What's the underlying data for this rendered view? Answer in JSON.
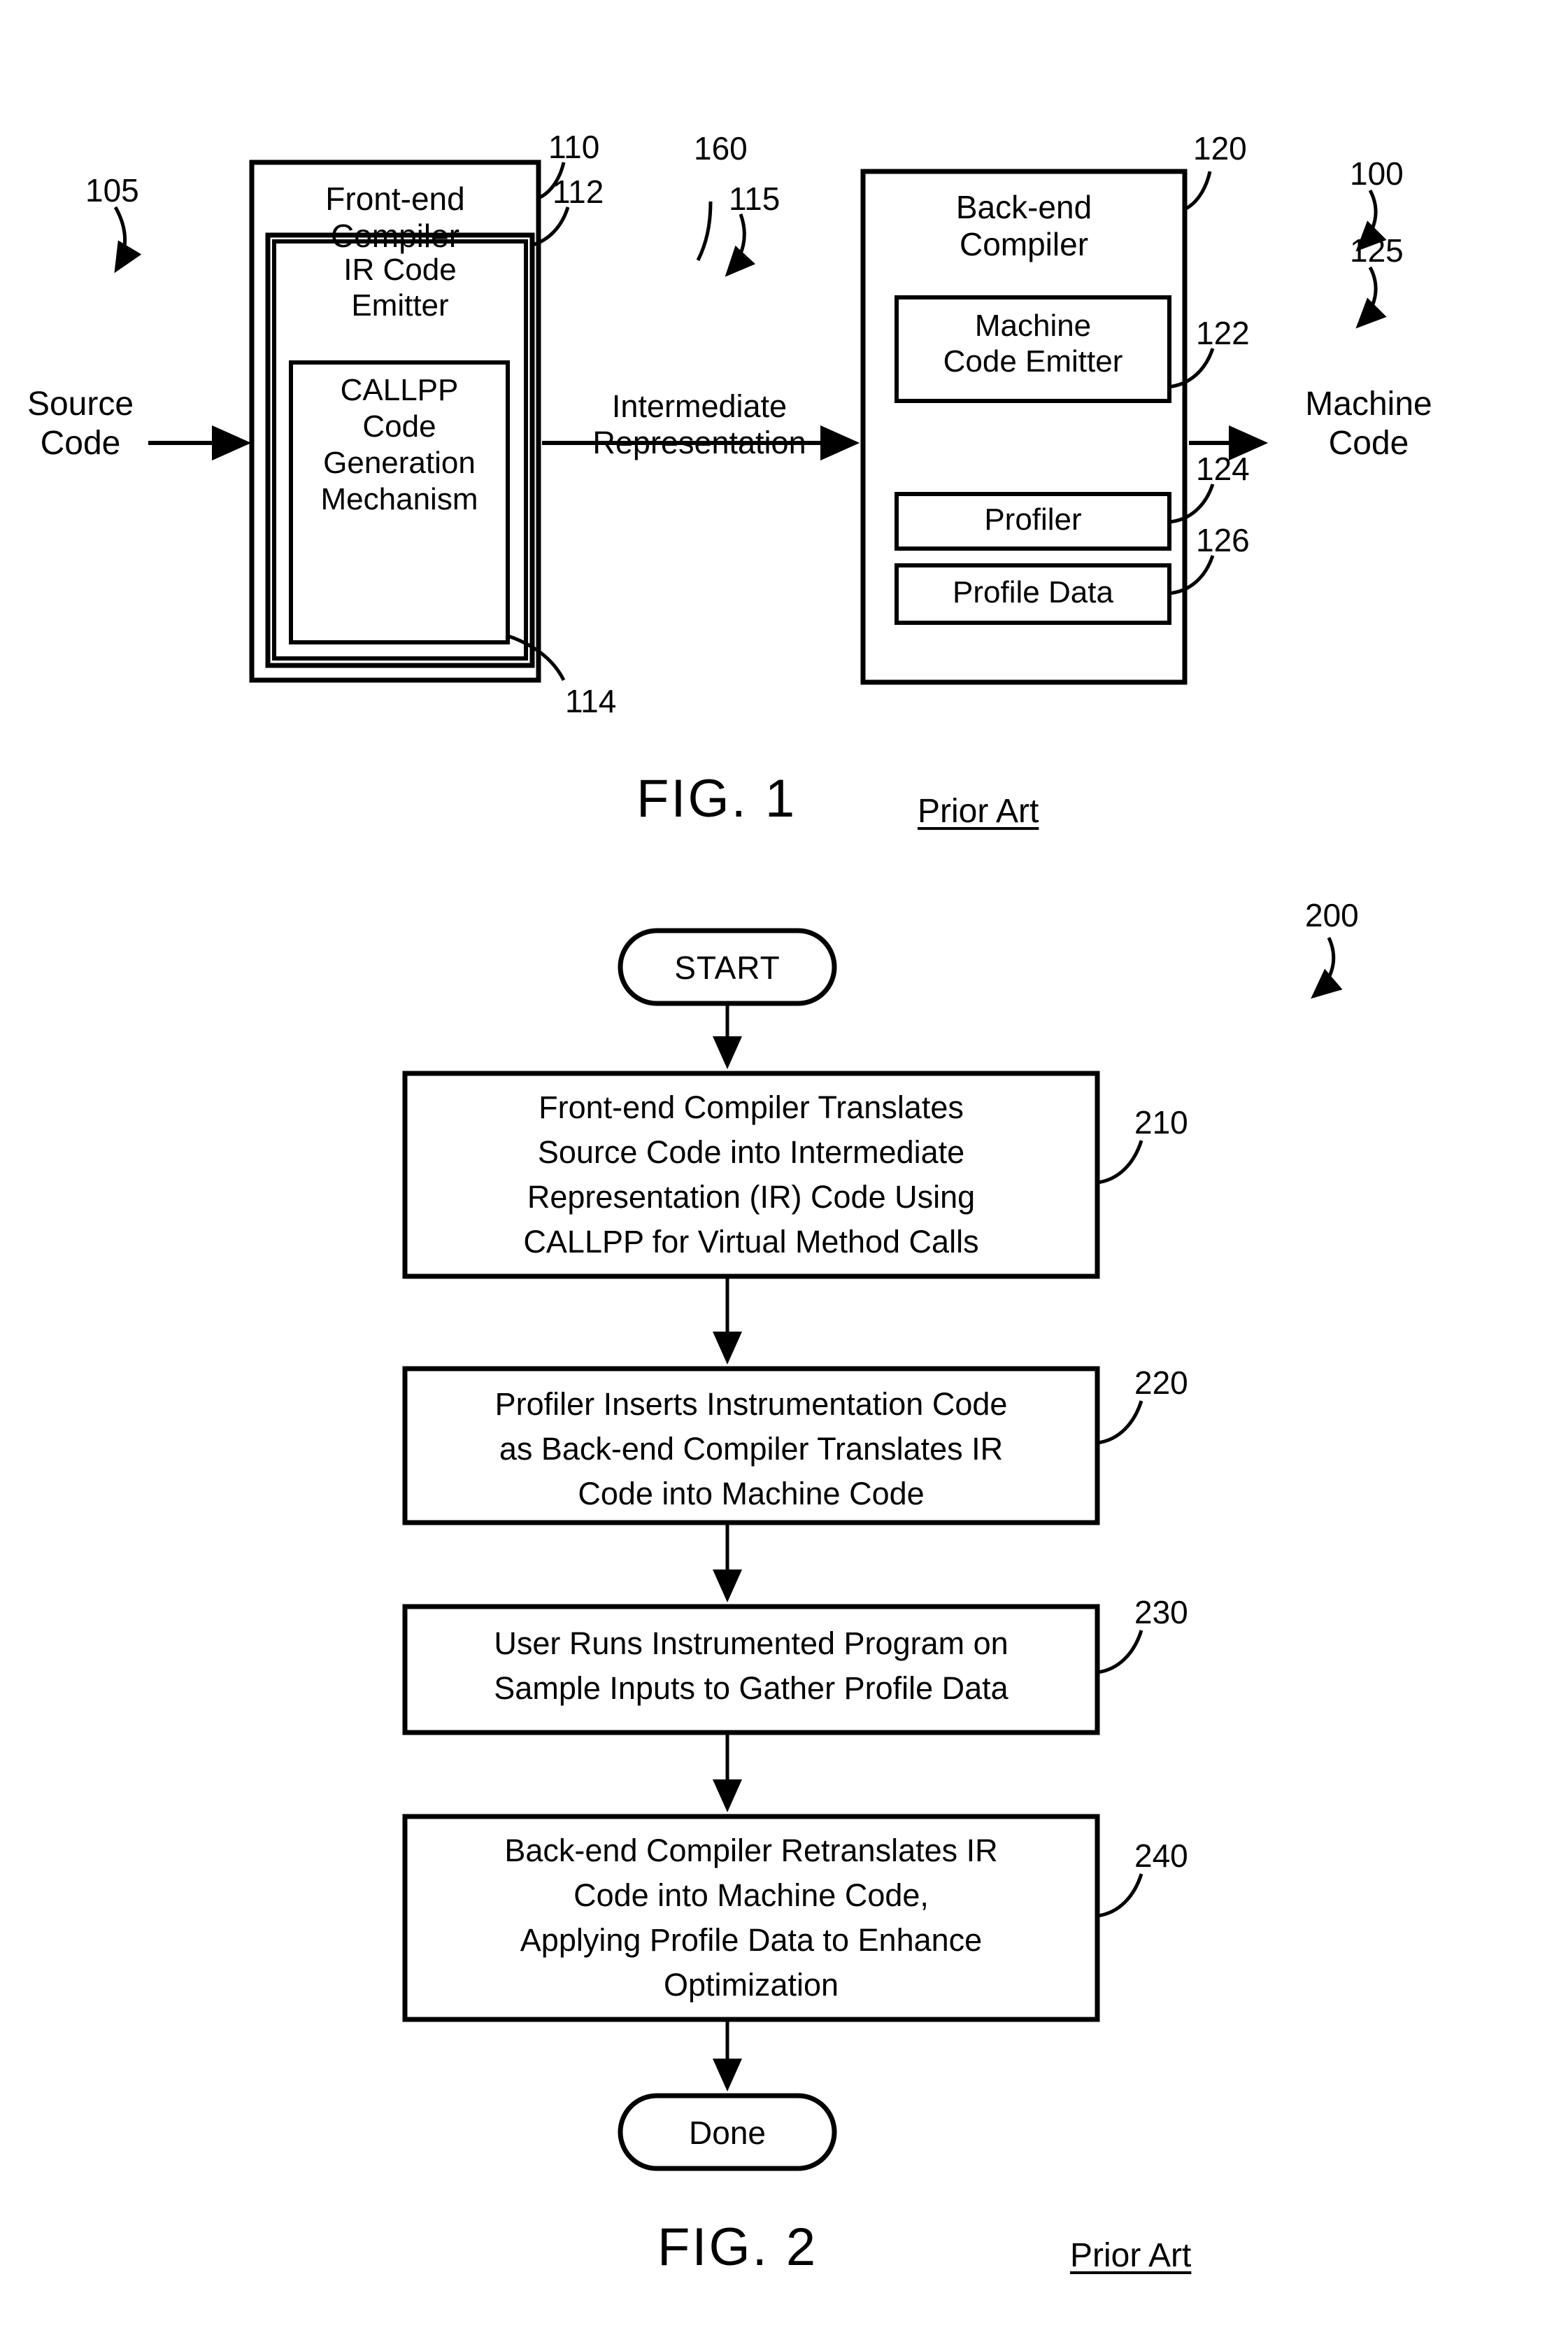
{
  "figures": [
    {
      "id": "fig1",
      "caption": "FIG. 1",
      "prior_art": "Prior Art",
      "system_ref": "100",
      "inputs": [
        {
          "label": "Source\nCode",
          "ref": "105"
        }
      ],
      "outputs": [
        {
          "label": "Machine\nCode",
          "ref": "125"
        }
      ],
      "flow_label": {
        "text": "Intermediate\nRepresentation",
        "ref": "115",
        "extra_ref": "160"
      },
      "blocks": [
        {
          "name": "front-end-compiler",
          "title": "Front-end\nCompiler",
          "ref": "110",
          "children": [
            {
              "name": "ir-code-emitter",
              "title": "IR Code\nEmitter",
              "ref": "112",
              "children": [
                {
                  "name": "callpp-code-generation-mechanism",
                  "title": "CALLPP\nCode\nGeneration\nMechanism",
                  "ref": "114"
                }
              ]
            }
          ]
        },
        {
          "name": "back-end-compiler",
          "title": "Back-end\nCompiler",
          "ref": "120",
          "children": [
            {
              "name": "machine-code-emitter",
              "title": "Machine\nCode Emitter",
              "ref": "122"
            },
            {
              "name": "profiler",
              "title": "Profiler",
              "ref": "124"
            },
            {
              "name": "profile-data",
              "title": "Profile Data",
              "ref": "126"
            }
          ]
        }
      ]
    },
    {
      "id": "fig2",
      "caption": "FIG. 2",
      "prior_art": "Prior Art",
      "method_ref": "200",
      "terminators": {
        "start": "START",
        "end": "Done"
      },
      "steps": [
        {
          "ref": "210",
          "text": "Front-end Compiler Translates\nSource Code into Intermediate\nRepresentation (IR) Code Using\nCALLPP for Virtual Method Calls"
        },
        {
          "ref": "220",
          "text": "Profiler Inserts Instrumentation Code\nas Back-end Compiler Translates IR\nCode into Machine Code"
        },
        {
          "ref": "230",
          "text": "User Runs Instrumented Program on\nSample Inputs to Gather Profile Data"
        },
        {
          "ref": "240",
          "text": "Back-end Compiler Retranslates IR\nCode into Machine Code,\nApplying Profile Data to Enhance\nOptimization"
        }
      ]
    }
  ],
  "colors": {
    "ink": "#000000",
    "paper": "#ffffff"
  }
}
